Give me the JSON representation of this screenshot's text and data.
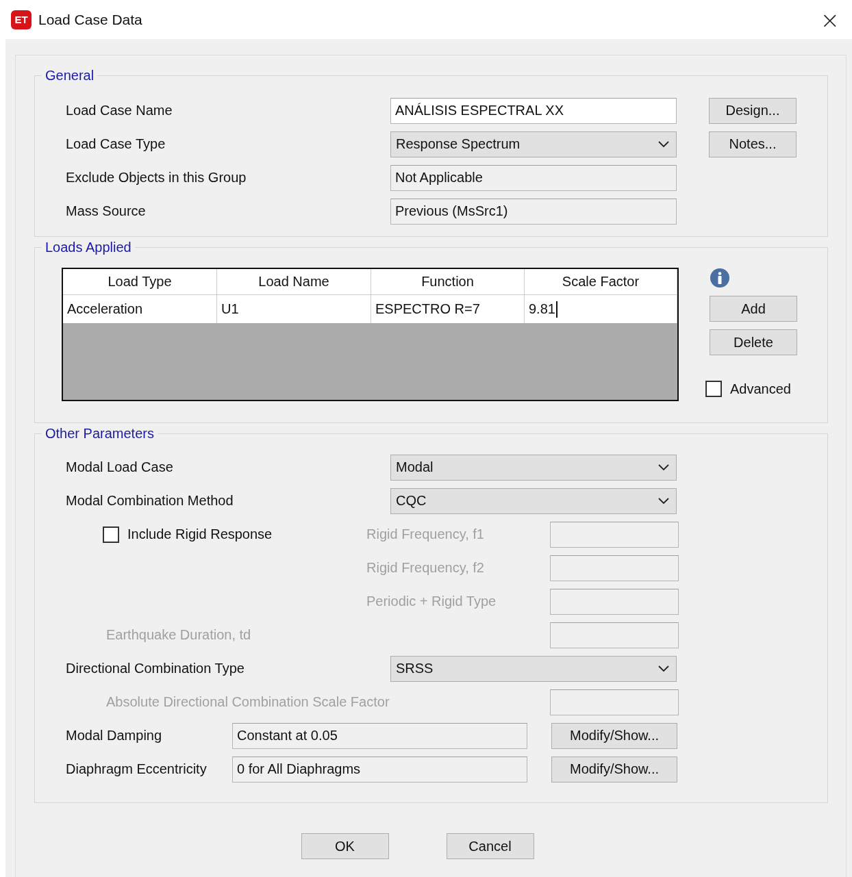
{
  "window": {
    "title": "Load Case Data",
    "app_badge": "ET",
    "close": "×"
  },
  "general": {
    "title": "General",
    "rows": [
      {
        "kind": "text",
        "label": "Load Case Name",
        "value": "ANÁLISIS ESPECTRAL XX"
      },
      {
        "kind": "dropdown",
        "label": "Load Case Type",
        "value": "Response Spectrum"
      },
      {
        "kind": "readonly",
        "label": "Exclude Objects in this Group",
        "value": "Not Applicable"
      },
      {
        "kind": "readonly",
        "label": "Mass Source",
        "value": "Previous  (MsSrc1)"
      }
    ],
    "buttons": [
      "Design...",
      "Notes..."
    ]
  },
  "loads_applied": {
    "title": "Loads Applied",
    "columns": [
      "Load Type",
      "Load Name",
      "Function",
      "Scale Factor"
    ],
    "rows": [
      [
        "Acceleration",
        "U1",
        "ESPECTRO R=7",
        "9.81"
      ]
    ],
    "buttons": [
      "Add",
      "Delete"
    ],
    "advanced": {
      "label": "Advanced",
      "checked": false
    }
  },
  "other_parameters": {
    "title": "Other Parameters",
    "rows": [
      {
        "kind": "dropdown",
        "label": "Modal Load Case",
        "value": "Modal"
      },
      {
        "kind": "dropdown",
        "label": "Modal Combination Method",
        "value": "CQC"
      },
      {
        "kind": "checkbox",
        "label": "Include Rigid Response",
        "checked": false,
        "field_label": "Rigid Frequency, f1",
        "disabled": true
      },
      {
        "kind": "sub",
        "field_label": "Rigid Frequency, f2",
        "disabled": true
      },
      {
        "kind": "sub",
        "field_label": "Periodic + Rigid Type",
        "disabled": true
      },
      {
        "kind": "indented",
        "label": "Earthquake Duration, td",
        "disabled": true
      },
      {
        "kind": "dropdown",
        "label": "Directional Combination Type",
        "value": "SRSS"
      },
      {
        "kind": "indented",
        "label": "Absolute Directional Combination Scale Factor",
        "disabled": true
      },
      {
        "kind": "button",
        "label": "Modal Damping",
        "value": "Constant at 0.05",
        "button": "Modify/Show..."
      },
      {
        "kind": "button",
        "label": "Diaphragm Eccentricity",
        "value": "0 for All Diaphragms",
        "button": "Modify/Show..."
      }
    ]
  },
  "buttons": [
    "OK",
    "Cancel"
  ]
}
